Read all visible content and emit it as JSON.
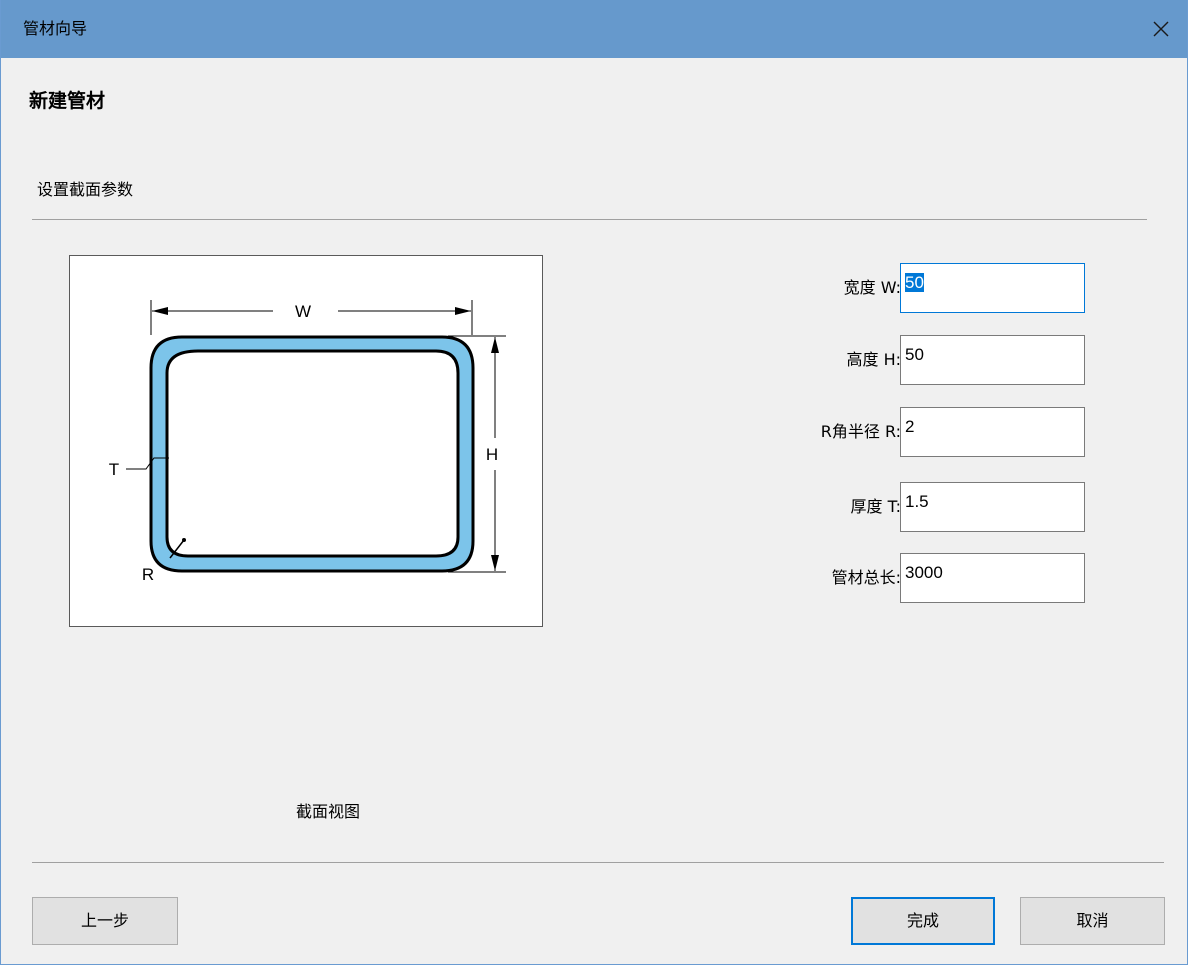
{
  "window": {
    "title": "管材向导",
    "close_icon": "close-icon"
  },
  "page": {
    "heading": "新建管材",
    "subheading": "设置截面参数"
  },
  "preview": {
    "caption": "截面视图",
    "labels": {
      "w": "W",
      "h": "H",
      "t": "T",
      "r": "R"
    },
    "colors": {
      "tube_fill": "#7cc4ea",
      "outline": "#000000"
    }
  },
  "fields": {
    "width": {
      "label": "宽度 W:",
      "value": "50"
    },
    "height": {
      "label": "高度 H:",
      "value": "50"
    },
    "radius": {
      "label": "R角半径 R:",
      "value": "2"
    },
    "thickness": {
      "label": "厚度 T:",
      "value": "1.5"
    },
    "length": {
      "label": "管材总长:",
      "value": "3000"
    }
  },
  "buttons": {
    "prev": "上一步",
    "finish": "完成",
    "cancel": "取消"
  }
}
